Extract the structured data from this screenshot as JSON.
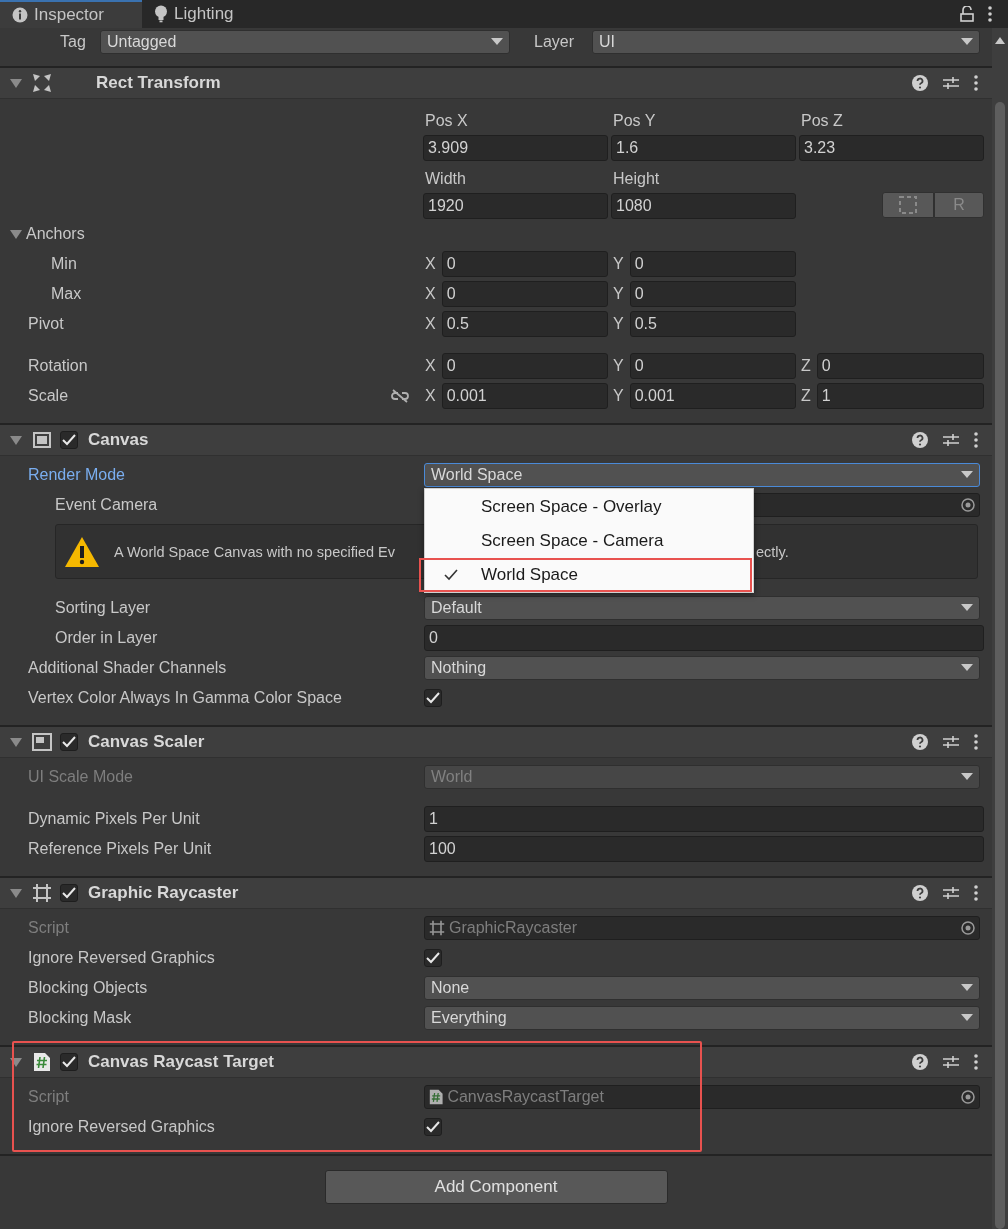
{
  "tabs": [
    {
      "label": "Inspector",
      "selected": true
    },
    {
      "label": "Lighting",
      "selected": false
    }
  ],
  "tag": {
    "label": "Tag",
    "value": "Untagged"
  },
  "layer": {
    "label": "Layer",
    "value": "UI"
  },
  "components": [
    {
      "title": "Rect Transform",
      "kind": "rect_transform",
      "expanded": true,
      "rows": [
        {
          "kind": "labeled_fields",
          "fields": [
            {
              "label": "Pos X",
              "value": "3.909"
            },
            {
              "label": "Pos Y",
              "value": "1.6"
            },
            {
              "label": "Pos Z",
              "value": "3.23"
            }
          ]
        },
        {
          "kind": "labeled_fields",
          "fields": [
            {
              "label": "Width",
              "value": "1920"
            },
            {
              "label": "Height",
              "value": "1080"
            }
          ],
          "buttons": [
            {
              "kind": "blueprint"
            },
            {
              "kind": "raw",
              "text": "R"
            }
          ]
        },
        {
          "kind": "foldout",
          "label": "Anchors",
          "expanded": true,
          "children": [
            {
              "kind": "axes",
              "label": "Min",
              "axes": [
                {
                  "axis": "X",
                  "value": "0"
                },
                {
                  "axis": "Y",
                  "value": "0"
                }
              ]
            },
            {
              "kind": "axes",
              "label": "Max",
              "axes": [
                {
                  "axis": "X",
                  "value": "0"
                },
                {
                  "axis": "Y",
                  "value": "0"
                }
              ]
            }
          ]
        },
        {
          "kind": "axes",
          "label": "Pivot",
          "axes": [
            {
              "axis": "X",
              "value": "0.5"
            },
            {
              "axis": "Y",
              "value": "0.5"
            }
          ]
        },
        {
          "kind": "axes",
          "label": "Rotation",
          "spaced": true,
          "axes": [
            {
              "axis": "X",
              "value": "0"
            },
            {
              "axis": "Y",
              "value": "0"
            },
            {
              "axis": "Z",
              "value": "0"
            }
          ]
        },
        {
          "kind": "axes",
          "label": "Scale",
          "constrain_proportions": false,
          "axes": [
            {
              "axis": "X",
              "value": "0.001"
            },
            {
              "axis": "Y",
              "value": "0.001"
            },
            {
              "axis": "Z",
              "value": "1"
            }
          ]
        }
      ]
    },
    {
      "title": "Canvas",
      "kind": "canvas",
      "enabled": true,
      "expanded": true,
      "rows": [
        {
          "kind": "dropdown",
          "label": "Render Mode",
          "value": "World Space",
          "focused": true,
          "popup": {
            "options": [
              {
                "label": "Screen Space - Overlay",
                "selected": false,
                "highlighted": false
              },
              {
                "label": "Screen Space - Camera",
                "selected": false,
                "highlighted": false
              },
              {
                "label": "World Space",
                "selected": true,
                "highlighted": true
              }
            ]
          },
          "children": [
            {
              "kind": "object",
              "label": "Event Camera"
            },
            {
              "kind": "help",
              "text_parts": [
                "A World Space Canvas with no specified Ev",
                "ectly."
              ]
            },
            {
              "kind": "dropdown",
              "label": "Sorting Layer",
              "value": "Default"
            },
            {
              "kind": "text",
              "label": "Order in Layer",
              "value": "0"
            }
          ]
        },
        {
          "kind": "dropdown",
          "label": "Additional Shader Channels",
          "value": "Nothing"
        },
        {
          "kind": "checkbox",
          "label": "Vertex Color Always In Gamma Color Space",
          "checked": true
        }
      ]
    },
    {
      "title": "Canvas Scaler",
      "kind": "canvas_scaler",
      "enabled": true,
      "expanded": true,
      "rows": [
        {
          "kind": "dropdown",
          "label": "UI Scale Mode",
          "value": "World",
          "disabled": true
        },
        {
          "kind": "text",
          "label": "Dynamic Pixels Per Unit",
          "value": "1",
          "spaced": true
        },
        {
          "kind": "text",
          "label": "Reference Pixels Per Unit",
          "value": "100"
        }
      ]
    },
    {
      "title": "Graphic Raycaster",
      "kind": "graphic_raycaster",
      "enabled": true,
      "expanded": true,
      "rows": [
        {
          "kind": "object",
          "label": "Script",
          "value": "GraphicRaycaster",
          "disabled": true
        },
        {
          "kind": "checkbox",
          "label": "Ignore Reversed Graphics",
          "checked": true
        },
        {
          "kind": "dropdown",
          "label": "Blocking Objects",
          "value": "None"
        },
        {
          "kind": "dropdown",
          "label": "Blocking Mask",
          "value": "Everything"
        }
      ]
    },
    {
      "title": "Canvas Raycast Target",
      "kind": "script",
      "enabled": true,
      "expanded": true,
      "highlighted": true,
      "rows": [
        {
          "kind": "object",
          "label": "Script",
          "value": "CanvasRaycastTarget",
          "disabled": true
        },
        {
          "kind": "checkbox",
          "label": "Ignore Reversed Graphics",
          "checked": true
        }
      ]
    }
  ],
  "add_button": "Add Component"
}
